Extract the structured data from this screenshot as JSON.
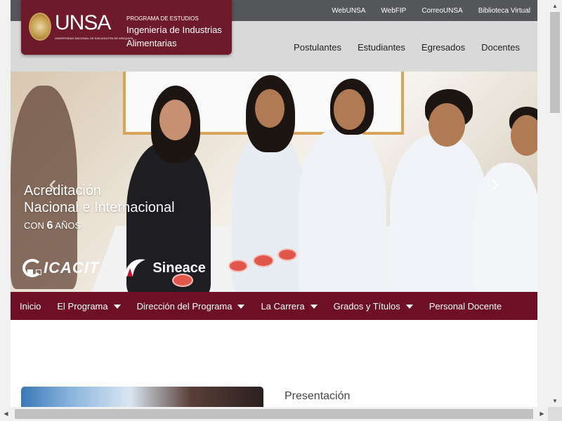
{
  "top_links": [
    "WebUNSA",
    "WebFIP",
    "CorreoUNSA",
    "Biblioteca Virtual"
  ],
  "brand": {
    "name": "UNSA",
    "university_full": "UNIVERSIDAD NACIONAL DE SAN AGUSTIN DE AREQUIPA",
    "program_label": "PROGRAMA DE ESTUDIOS",
    "program_name": "Ingeniería de Industrias Alimentarias"
  },
  "main_nav": [
    "Postulantes",
    "Estudiantes",
    "Egresados",
    "Docentes"
  ],
  "hero": {
    "caption_line1": "Acreditación",
    "caption_line2": "Nacional e Internacional",
    "caption_con": "CON",
    "caption_years": "6",
    "caption_unit": "AÑOS",
    "logo1": "ICACIT",
    "logo2": "Sineace",
    "prev_glyph": "‹",
    "next_glyph": "›",
    "slides": 2,
    "active_slide": 1
  },
  "sub_nav": [
    {
      "label": "Inicio",
      "dropdown": false
    },
    {
      "label": "El Programa",
      "dropdown": true
    },
    {
      "label": "Dirección del Programa",
      "dropdown": true
    },
    {
      "label": "La Carrera",
      "dropdown": true
    },
    {
      "label": "Grados y Títulos",
      "dropdown": true
    },
    {
      "label": "Personal Docente",
      "dropdown": false
    }
  ],
  "content": {
    "section_title": "Presentación"
  },
  "scrollbar": {
    "up": "▲",
    "down": "▼",
    "left": "◀",
    "right": "▶"
  }
}
